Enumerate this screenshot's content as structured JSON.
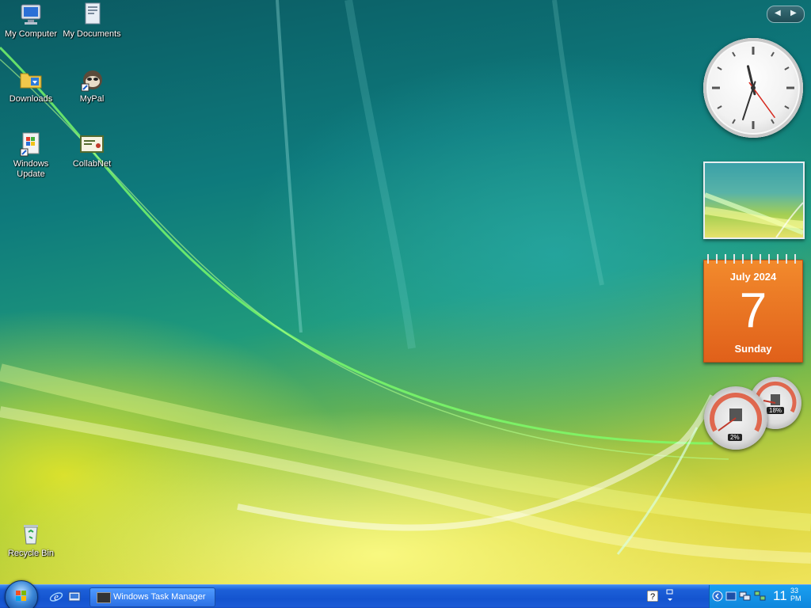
{
  "desktop": {
    "icons": [
      {
        "label": "My Computer"
      },
      {
        "label": "My Documents"
      },
      {
        "label": "Downloads"
      },
      {
        "label": "MyPal"
      },
      {
        "label": "Windows Update"
      },
      {
        "label": "CollabNet"
      },
      {
        "label": "Recycle Bin"
      }
    ]
  },
  "sidebar": {
    "nav_prev_icon": "chevron-left-icon",
    "nav_next_icon": "chevron-right-icon",
    "clock": {
      "hour": 11,
      "minute": 33,
      "second": 24
    },
    "calendar": {
      "month_year": "July 2024",
      "day": "7",
      "weekday": "Sunday"
    },
    "cpu_meter": {
      "cpu_value": "2%",
      "memory_value": "18%"
    }
  },
  "taskbar": {
    "task_button_label": "Windows Task Manager",
    "clock": {
      "hour": "11",
      "minute": "33",
      "ampm": "PM"
    }
  },
  "colors": {
    "taskbar": "#1454cf",
    "tray": "#0f86dc",
    "calendar": "#e8701f"
  }
}
